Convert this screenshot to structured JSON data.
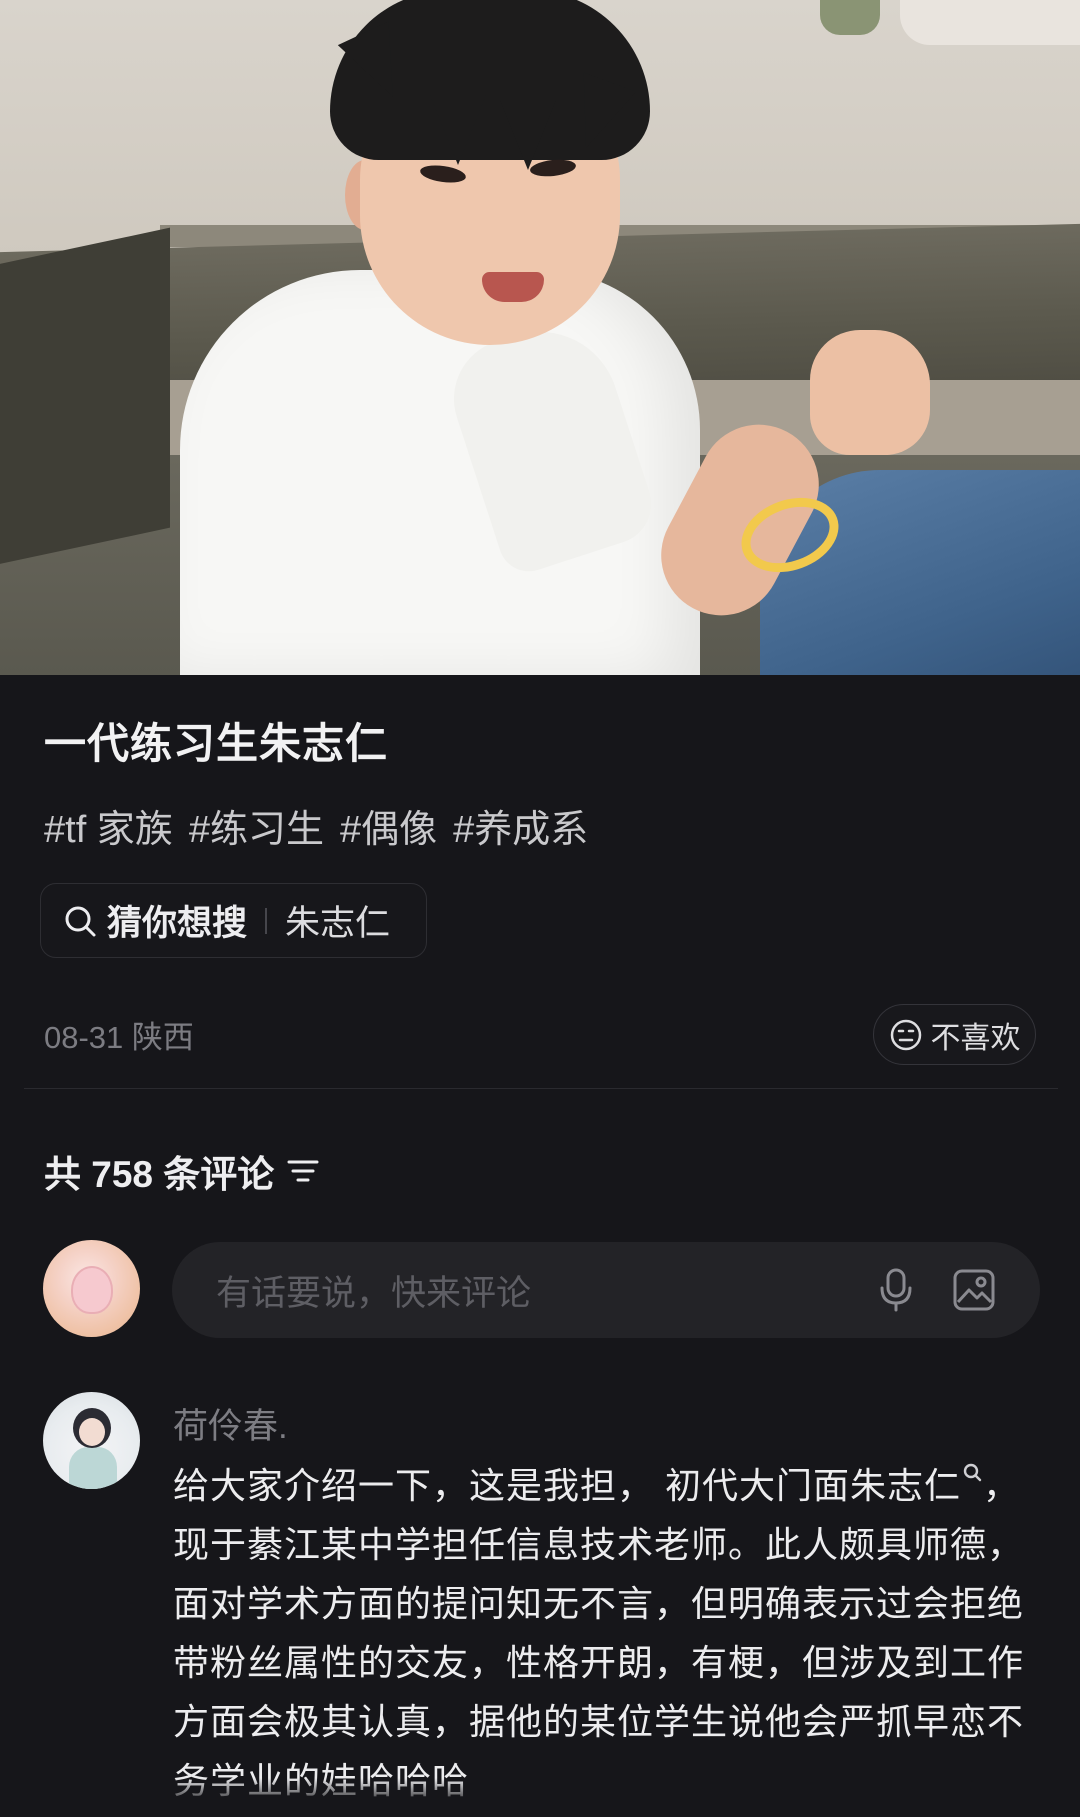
{
  "post": {
    "title": "一代练习生朱志仁",
    "tags": [
      "#tf 家族",
      "#练习生",
      "#偶像",
      "#养成系"
    ],
    "suggest": {
      "label": "猜你想搜",
      "term": "朱志仁"
    },
    "meta": "08-31 陕西",
    "dislike_label": "不喜欢"
  },
  "comments": {
    "count_label": "共 758 条评论",
    "input_placeholder": "有话要说，快来评论",
    "items": [
      {
        "author": "荷伶春.",
        "text_before": "给大家介绍一下，这是我担，",
        "mention": "初代大门面朱志仁",
        "text_after": "，现于綦江某中学担任信息技术老师。此人颇具师德，面对学术方面的提问知无不言，但明确表示过会拒绝带粉丝属性的交友，性格开朗，有梗，但涉及到工作方面会极其认真，据他的某位学生说他会严抓早恋不务学业的娃哈哈哈"
      }
    ]
  },
  "icons": {
    "search": "search-icon",
    "dislike": "unhappy-face-icon",
    "filter": "filter-lines-icon",
    "mic": "microphone-icon",
    "image": "image-icon"
  },
  "colors": {
    "background": "#16161a",
    "text_primary": "#f2f2f3",
    "text_muted": "#7c7c82",
    "input_bg": "#232327"
  }
}
